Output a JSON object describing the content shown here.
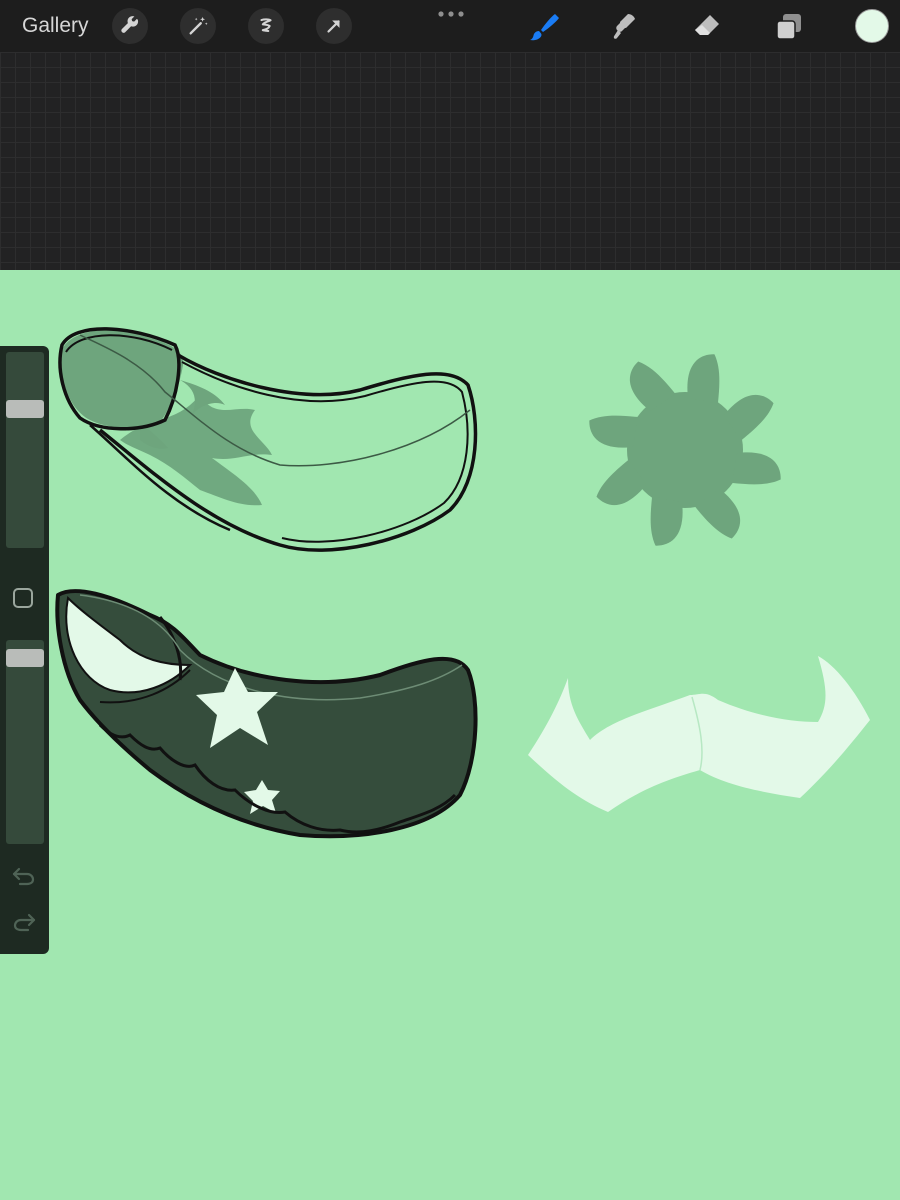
{
  "toolbar": {
    "gallery_label": "Gallery",
    "left_tools": [
      {
        "icon": "wrench-icon",
        "name": "actions"
      },
      {
        "icon": "magic-wand-icon",
        "name": "adjustments"
      },
      {
        "icon": "selection-icon",
        "name": "selection"
      },
      {
        "icon": "arrow-transform-icon",
        "name": "transform"
      }
    ],
    "more_icon": "ellipsis-icon",
    "right_tools": [
      {
        "icon": "brush-icon",
        "name": "paint",
        "active": true
      },
      {
        "icon": "smudge-icon",
        "name": "smudge",
        "active": false
      },
      {
        "icon": "eraser-icon",
        "name": "erase",
        "active": false
      },
      {
        "icon": "layers-icon",
        "name": "layers",
        "active": false
      }
    ],
    "current_color": "#e3f9e8",
    "active_tool_color": "#1a7cf5"
  },
  "canvas": {
    "background_color": "#a1e7b0",
    "grid_background": "#222223"
  },
  "sidebar": {
    "brush_size_level": 0.73,
    "opacity_level": 0.95,
    "icons": [
      "modify-square-icon",
      "undo-icon",
      "redo-icon"
    ]
  }
}
